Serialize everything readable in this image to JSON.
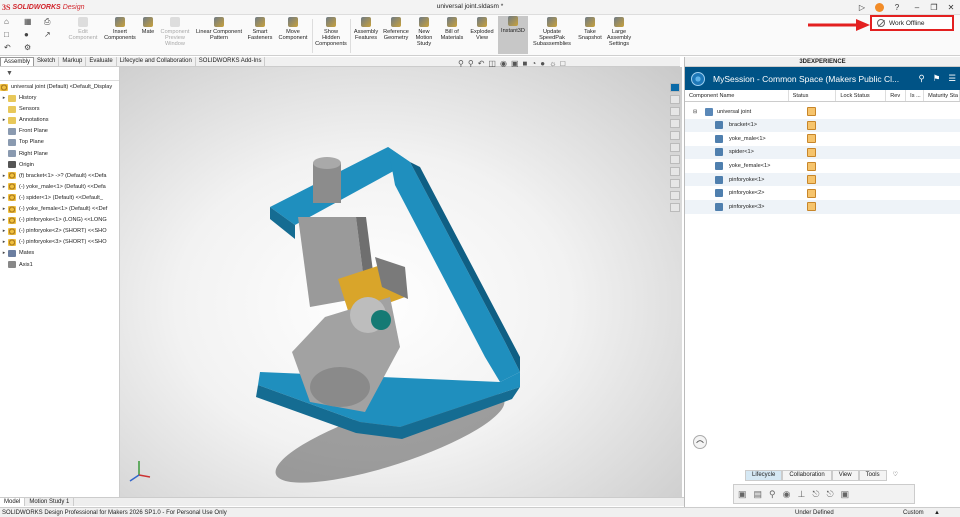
{
  "titlebar": {
    "brand_ds": "3S",
    "brand_bold": "SOLIDWORKS",
    "brand_rest": "Design",
    "document": "universal joint.sldasm *"
  },
  "ribbon": {
    "items": [
      {
        "label": "Edit\nComponent",
        "enabled": false
      },
      {
        "label": "Insert\nComponents",
        "enabled": true
      },
      {
        "label": "Mate",
        "enabled": true
      },
      {
        "label": "Component\nPreview\nWindow",
        "enabled": false
      },
      {
        "label": "Linear Component\nPattern",
        "enabled": true
      },
      {
        "label": "Smart\nFasteners",
        "enabled": true
      },
      {
        "label": "Move\nComponent",
        "enabled": true
      },
      {
        "label": "Show\nHidden\nComponents",
        "enabled": true
      },
      {
        "label": "Assembly\nFeatures",
        "enabled": true
      },
      {
        "label": "Reference\nGeometry",
        "enabled": true
      },
      {
        "label": "New\nMotion\nStudy",
        "enabled": true
      },
      {
        "label": "Bill of\nMaterials",
        "enabled": true
      },
      {
        "label": "Exploded\nView",
        "enabled": true
      },
      {
        "label": "Instant3D",
        "enabled": true,
        "active": true
      },
      {
        "label": "Update\nSpeedPak\nSubassemblies",
        "enabled": true
      },
      {
        "label": "Take\nSnapshot",
        "enabled": true
      },
      {
        "label": "Large\nAssembly\nSettings",
        "enabled": true
      }
    ],
    "work_offline": "Work Offline"
  },
  "command_tabs": [
    "Assembly",
    "Sketch",
    "Markup",
    "Evaluate",
    "Lifecycle and Collaboration",
    "SOLIDWORKS Add-Ins"
  ],
  "tree": {
    "root": "universal joint (Default) <Default_Display",
    "items": [
      {
        "label": "History",
        "kind": "folder"
      },
      {
        "label": "Sensors",
        "kind": "folder"
      },
      {
        "label": "Annotations",
        "kind": "folder"
      },
      {
        "label": "Front Plane",
        "kind": "plane"
      },
      {
        "label": "Top Plane",
        "kind": "plane"
      },
      {
        "label": "Right Plane",
        "kind": "plane"
      },
      {
        "label": "Origin",
        "kind": "origin"
      },
      {
        "label": "(f) bracket<1> ->? (Default) <<Defa",
        "kind": "part"
      },
      {
        "label": "(-) yoke_male<1> (Default) <<Defa",
        "kind": "part"
      },
      {
        "label": "(-) spider<1> (Default) <<Default_",
        "kind": "part"
      },
      {
        "label": "(-) yoke_female<1> (Default) <<Def",
        "kind": "part"
      },
      {
        "label": "(-) pinforyoke<1> (LONG) <<LONG",
        "kind": "part"
      },
      {
        "label": "(-) pinforyoke<2> (SHORT) <<SHO",
        "kind": "part"
      },
      {
        "label": "(-) pinforyoke<3> (SHORT) <<SHO",
        "kind": "part"
      },
      {
        "label": "Mates",
        "kind": "mates"
      },
      {
        "label": "Axis1",
        "kind": "axis"
      }
    ]
  },
  "panel": {
    "header": "3DEXPERIENCE",
    "session": "MySession - Common Space (Makers Public Cl...",
    "columns": [
      "Component Name",
      "Status",
      "Lock Status",
      "Rev",
      "Is ...",
      "Maturity Sta"
    ],
    "root": "universal joint",
    "components": [
      "bracket<1>",
      "yoke_male<1>",
      "spider<1>",
      "yoke_female<1>",
      "pinforyoke<1>",
      "pinforyoke<2>",
      "pinforyoke<3>"
    ],
    "tabs": [
      "Lifecycle",
      "Collaboration",
      "View",
      "Tools"
    ]
  },
  "bottom_tabs": [
    "Model",
    "Motion Study 1"
  ],
  "status": {
    "left": "SOLIDWORKS Design Professional for Makers 2026 SP1.0 - For Personal Use Only",
    "state": "Under Defined",
    "units": "Custom"
  },
  "colors": {
    "accent": "#005386",
    "model_blue": "#1f8fbe",
    "highlight": "#e32020",
    "yellow_face": "#d9a52a"
  }
}
